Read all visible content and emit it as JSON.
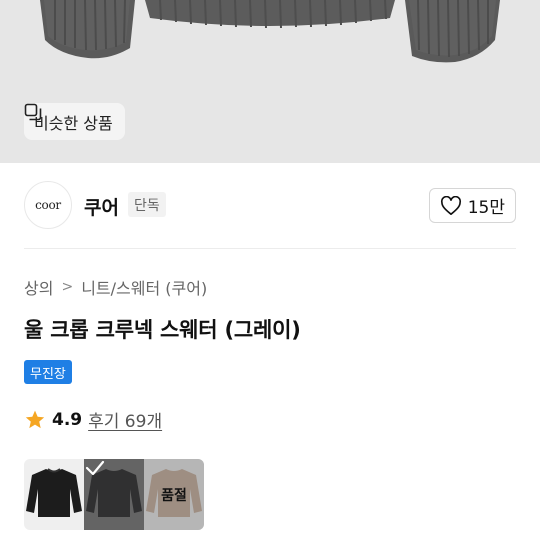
{
  "hero": {
    "similar_label": "비슷한 상품"
  },
  "brand": {
    "logo_text": "coor",
    "name": "쿠어",
    "badge": "단독",
    "like_count": "15만"
  },
  "breadcrumb": {
    "items": [
      "상의",
      "니트/스웨터 (쿠어)"
    ],
    "separator": ">"
  },
  "product": {
    "title": "울 크롭 크루넥 스웨터 (그레이)",
    "tag": "무진장"
  },
  "rating": {
    "score": "4.9",
    "reviews_label": "후기 69개"
  },
  "swatches": [
    {
      "color_name": "black",
      "color": "#1c1c1c",
      "state": "default"
    },
    {
      "color_name": "gray",
      "color": "#4a4a4c",
      "state": "selected"
    },
    {
      "color_name": "brown",
      "color": "#6b5240",
      "state": "soldout",
      "label": "품절"
    }
  ],
  "colors": {
    "accent_blue": "#1f7fe5",
    "star": "#f5a623"
  }
}
